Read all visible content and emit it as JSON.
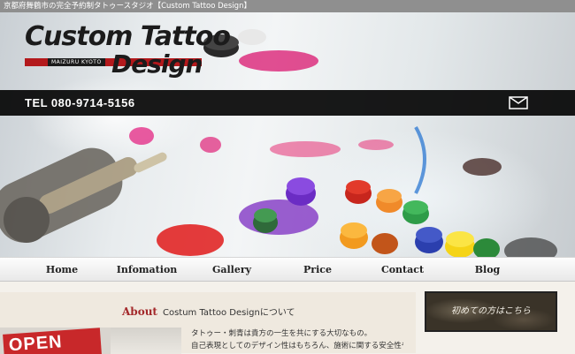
{
  "top_bar": {
    "text": "京都府舞鶴市の完全予約制タトゥースタジオ【Custom Tattoo Design】"
  },
  "logo": {
    "line1": "Custom Tattoo",
    "line2": "Design",
    "subtitle": "MAIZURU KYOTO"
  },
  "contact": {
    "tel": "TEL 080-9714-5156",
    "mail_icon": "envelope-icon"
  },
  "nav": {
    "items": [
      {
        "label": "Home"
      },
      {
        "label": "Infomation"
      },
      {
        "label": "Gallery"
      },
      {
        "label": "Price"
      },
      {
        "label": "Contact"
      },
      {
        "label": "Blog"
      }
    ]
  },
  "about": {
    "title": "About",
    "subtitle": "Costum Tattoo Designについて",
    "photo_sign": "OPEN",
    "paragraphs": [
      "タトゥー・刺青は貴方の一生を共にする大切なもの。",
      "自己表現としてのデザイン性はもちろん、施術に関する安全性や"
    ]
  },
  "sidebar": {
    "banner_label": "初めての方はこちら"
  },
  "colors": {
    "accent_red": "#a3282a",
    "bar_black": "#000000"
  }
}
